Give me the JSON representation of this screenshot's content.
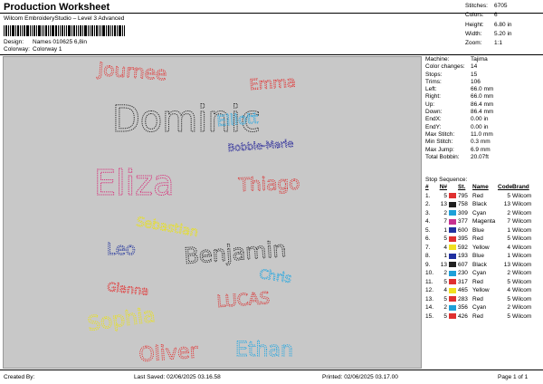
{
  "header": {
    "title": "Production Worksheet",
    "subtitle": "Wilcom EmbroideryStudio – Level 3 Advanced",
    "design_label": "Design:",
    "design_value": "Names 010625 6,8in",
    "colorway_label": "Colorway:",
    "colorway_value": "Colorway 1"
  },
  "summary": [
    {
      "k": "Stitches:",
      "v": "6705"
    },
    {
      "k": "Colors:",
      "v": "6"
    },
    {
      "k": "Height:",
      "v": "6.80 in"
    },
    {
      "k": "Width:",
      "v": "5.20 in"
    },
    {
      "k": "Zoom:",
      "v": "1:1"
    }
  ],
  "details": [
    {
      "k": "Machine:",
      "v": "Tajima"
    },
    {
      "k": "Color changes:",
      "v": "14"
    },
    {
      "k": "Stops:",
      "v": "15"
    },
    {
      "k": "Trims:",
      "v": "106"
    },
    {
      "k": "Left:",
      "v": "66.0 mm"
    },
    {
      "k": "Right:",
      "v": "66.0 mm"
    },
    {
      "k": "Up:",
      "v": "86.4 mm"
    },
    {
      "k": "Down:",
      "v": "86.4 mm"
    },
    {
      "k": "EndX:",
      "v": "0.00 in"
    },
    {
      "k": "EndY:",
      "v": "0.00 in"
    },
    {
      "k": "Max Stitch:",
      "v": "11.0 mm"
    },
    {
      "k": "Min Stitch:",
      "v": "0.3 mm"
    },
    {
      "k": "Max Jump:",
      "v": "6.9 mm"
    },
    {
      "k": "Total Bobbin:",
      "v": "20.07ft"
    }
  ],
  "stops": {
    "section_label": "Stop Sequence:",
    "headers": [
      "#",
      "N#",
      "St.",
      "Name",
      "Code",
      "Brand"
    ],
    "rows": [
      {
        "n": "1.",
        "no": "5",
        "color": "#e03030",
        "st": "795",
        "name": "Red",
        "code": "5",
        "brand": "Wilcom"
      },
      {
        "n": "2.",
        "no": "13",
        "color": "#202020",
        "st": "758",
        "name": "Black",
        "code": "13",
        "brand": "Wilcom"
      },
      {
        "n": "3.",
        "no": "2",
        "color": "#1ea0d8",
        "st": "309",
        "name": "Cyan",
        "code": "2",
        "brand": "Wilcom"
      },
      {
        "n": "4.",
        "no": "7",
        "color": "#c83090",
        "st": "377",
        "name": "Magenta",
        "code": "7",
        "brand": "Wilcom"
      },
      {
        "n": "5.",
        "no": "1",
        "color": "#2030a0",
        "st": "600",
        "name": "Blue",
        "code": "1",
        "brand": "Wilcom"
      },
      {
        "n": "6.",
        "no": "5",
        "color": "#e03030",
        "st": "395",
        "name": "Red",
        "code": "5",
        "brand": "Wilcom"
      },
      {
        "n": "7.",
        "no": "4",
        "color": "#f0e020",
        "st": "592",
        "name": "Yellow",
        "code": "4",
        "brand": "Wilcom"
      },
      {
        "n": "8.",
        "no": "1",
        "color": "#2030a0",
        "st": "193",
        "name": "Blue",
        "code": "1",
        "brand": "Wilcom"
      },
      {
        "n": "9.",
        "no": "13",
        "color": "#202020",
        "st": "607",
        "name": "Black",
        "code": "13",
        "brand": "Wilcom"
      },
      {
        "n": "10.",
        "no": "2",
        "color": "#1ea0d8",
        "st": "230",
        "name": "Cyan",
        "code": "2",
        "brand": "Wilcom"
      },
      {
        "n": "11.",
        "no": "5",
        "color": "#e03030",
        "st": "317",
        "name": "Red",
        "code": "5",
        "brand": "Wilcom"
      },
      {
        "n": "12.",
        "no": "4",
        "color": "#f0e020",
        "st": "465",
        "name": "Yellow",
        "code": "4",
        "brand": "Wilcom"
      },
      {
        "n": "13.",
        "no": "5",
        "color": "#e03030",
        "st": "283",
        "name": "Red",
        "code": "5",
        "brand": "Wilcom"
      },
      {
        "n": "14.",
        "no": "2",
        "color": "#1ea0d8",
        "st": "356",
        "name": "Cyan",
        "code": "2",
        "brand": "Wilcom"
      },
      {
        "n": "15.",
        "no": "5",
        "color": "#e03030",
        "st": "426",
        "name": "Red",
        "code": "5",
        "brand": "Wilcom"
      }
    ]
  },
  "canvas_names": [
    {
      "text": "Journee",
      "color": "#e04040"
    },
    {
      "text": "Emma",
      "color": "#e04040"
    },
    {
      "text": "Dominic",
      "color": "#303030"
    },
    {
      "text": "Elliott",
      "color": "#2aa8e0"
    },
    {
      "text": "Bobbie-Marie",
      "color": "#4040a0"
    },
    {
      "text": "Eliza",
      "color": "#d8307a"
    },
    {
      "text": "Thiago",
      "color": "#d84040"
    },
    {
      "text": "Sebastian",
      "color": "#e8e020"
    },
    {
      "text": "Leo",
      "color": "#3040a0"
    },
    {
      "text": "Benjamin",
      "color": "#303030"
    },
    {
      "text": "Chris",
      "color": "#2aa8e0"
    },
    {
      "text": "Gianna",
      "color": "#e04040"
    },
    {
      "text": "LUCAS",
      "color": "#d84040"
    },
    {
      "text": "Sophia",
      "color": "#e8e020"
    },
    {
      "text": "Oliver",
      "color": "#e04040"
    },
    {
      "text": "Ethan",
      "color": "#2aa8e0"
    }
  ],
  "footer": {
    "created": "Created By:",
    "saved": "Last Saved: 02/06/2025 03.16.58",
    "printed": "Printed: 02/06/2025 03.17.00",
    "page": "Page 1 of 1"
  }
}
